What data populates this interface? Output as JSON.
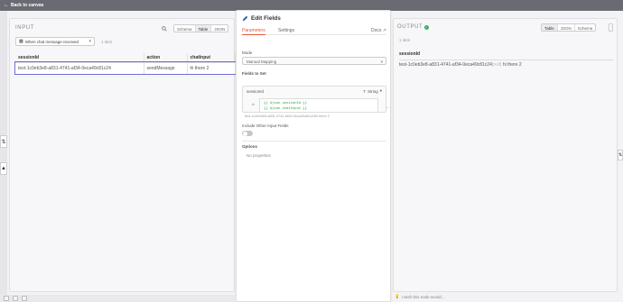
{
  "topbar": {
    "back_label": "Back to canvas"
  },
  "input": {
    "title": "INPUT",
    "view_tabs": [
      "Schema",
      "Table",
      "JSON"
    ],
    "active_view": "Table",
    "trigger_select": "When chat message received",
    "item_count": "1 item",
    "columns": [
      "sessionId",
      "action",
      "chatInput"
    ],
    "rows": [
      [
        "test-1c0eb3e8-a831-4741-af34-0eca49c81c24",
        "sendMessage",
        "hi there 2"
      ]
    ]
  },
  "node": {
    "title": "Edit Fields",
    "tabs": [
      "Parameters",
      "Settings"
    ],
    "active_tab": "Parameters",
    "docs_label": "Docs",
    "mode_label": "Mode",
    "mode_value": "Manual Mapping",
    "fields_label": "Fields to Set",
    "field": {
      "name": "sessionId",
      "type": "String",
      "expression_lines": [
        "{{ $json.sessionId }}",
        "{{ $json.chatInput }}"
      ],
      "result_preview": "test-1c0eb3e8-a831-4741-af34-0eca49c81c24hi there 2"
    },
    "include_label": "Include Other Input Fields",
    "include_enabled": false,
    "options_label": "Options",
    "no_properties": "No properties"
  },
  "output": {
    "title": "OUTPUT",
    "view_tabs": [
      "Table",
      "JSON",
      "Schema"
    ],
    "active_view": "Table",
    "more_label": "⋮",
    "item_count": "1 item",
    "columns": [
      "sessionId"
    ],
    "rows": [
      {
        "value": "test-1c0eb3e8-a831-4741-af34-0eca49c81c24",
        "suffix": "[null]",
        "tail": "hi there 2"
      }
    ]
  },
  "footer": {
    "wish_text": "I wish this node would..."
  },
  "colors": {
    "accent": "#e15a3a",
    "success": "#3aa75a",
    "selection": "#6e6ed6",
    "expression": "#2a9d3a"
  },
  "icons": [
    "back-arrow-icon",
    "search-icon",
    "pencil-icon",
    "external-link-icon",
    "check-circle-icon",
    "chat-icon",
    "lightbulb-icon"
  ]
}
